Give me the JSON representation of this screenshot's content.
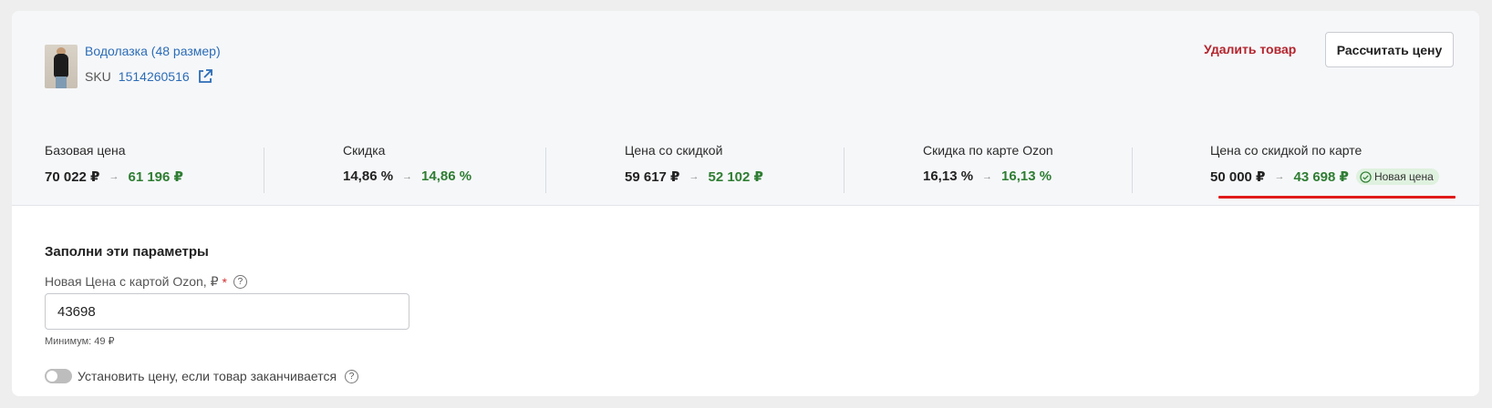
{
  "product": {
    "title": "Водолазка (48 размер)",
    "sku_label": "SKU",
    "sku_value": "1514260516"
  },
  "actions": {
    "delete_label": "Удалить товар",
    "calc_label": "Рассчитать цену"
  },
  "metrics": [
    {
      "label": "Базовая цена",
      "old": "70 022 ₽",
      "new": "61 196 ₽"
    },
    {
      "label": "Скидка",
      "old": "14,86 %",
      "new": "14,86 %"
    },
    {
      "label": "Цена со скидкой",
      "old": "59 617 ₽",
      "new": "52 102 ₽"
    },
    {
      "label": "Скидка по карте Ozon",
      "old": "16,13 %",
      "new": "16,13 %"
    },
    {
      "label": "Цена со скидкой по карте",
      "old": "50 000 ₽",
      "new": "43 698 ₽",
      "badge": "Новая цена"
    }
  ],
  "form": {
    "section_title": "Заполни эти параметры",
    "price_label": "Новая Цена с картой Ozon, ₽",
    "required_mark": "*",
    "price_value": "43698",
    "hint": "Минимум: 49 ₽",
    "toggle_label": "Установить цену, если товар заканчивается",
    "toggle_on": false
  },
  "colors": {
    "link": "#2b6cb6",
    "danger": "#b3242d",
    "new_value": "#2e7d32",
    "highlight": "#e01b1b"
  }
}
